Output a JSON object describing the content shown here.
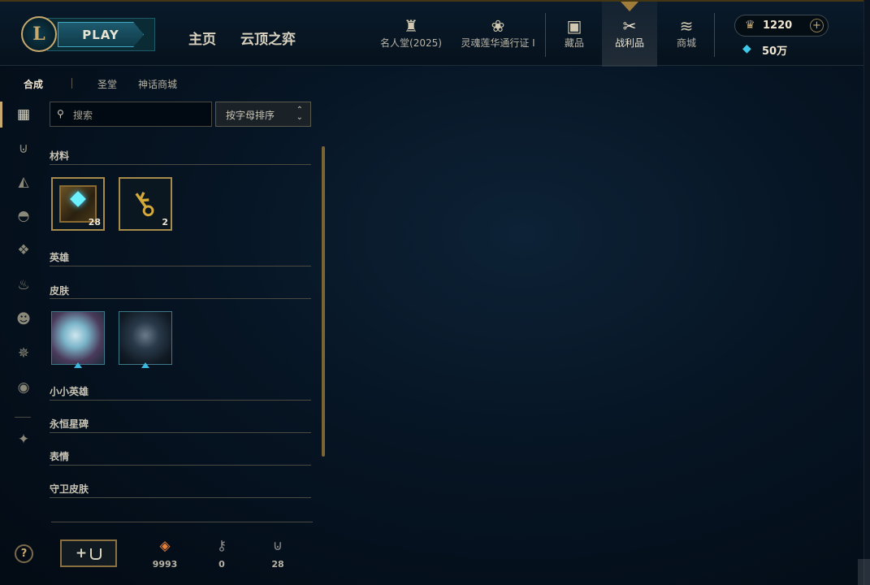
{
  "header": {
    "logo_letter": "L",
    "play_label": "PLAY",
    "main_nav": [
      "主页",
      "云顶之弈"
    ],
    "icon_nav": [
      {
        "label": "名人堂(2025)",
        "icon": "hall-of-fame-icon",
        "glyph": "♜"
      },
      {
        "label": "灵魂莲华通行证 I",
        "icon": "lotus-icon",
        "glyph": "❀"
      },
      {
        "label": "藏品",
        "icon": "collection-bag-icon",
        "glyph": "▣"
      },
      {
        "label": "战利品",
        "icon": "loot-icon",
        "glyph": "✂"
      },
      {
        "label": "商城",
        "icon": "store-coins-icon",
        "glyph": "≋"
      }
    ],
    "active_nav": "战利品",
    "rp_value": "1220",
    "blue_essence_value": "50万",
    "accent_color": "#c8aa6e"
  },
  "subtabs": {
    "items": [
      "合成",
      "圣堂",
      "神话商城"
    ],
    "active": "合成"
  },
  "sidebar": {
    "icons": [
      {
        "name": "all-items-grid-icon",
        "glyph": "▦",
        "active": true
      },
      {
        "name": "chest-icon",
        "glyph": "⊍"
      },
      {
        "name": "champion-helmet-icon",
        "glyph": "◭"
      },
      {
        "name": "skin-mask-icon",
        "glyph": "◓"
      },
      {
        "name": "little-legend-icon",
        "glyph": "❖"
      },
      {
        "name": "ward-flame-icon",
        "glyph": "♨"
      },
      {
        "name": "emote-icon",
        "glyph": "☻"
      },
      {
        "name": "eternals-icon",
        "glyph": "✵"
      },
      {
        "name": "summoner-icon-icon",
        "glyph": "◉"
      },
      {
        "name": "mythic-essence-icon",
        "glyph": "✦"
      }
    ]
  },
  "search": {
    "placeholder": "搜索",
    "value": ""
  },
  "sort": {
    "label": "按字母排序"
  },
  "sections": {
    "materials": "材料",
    "champions": "英雄",
    "skins": "皮肤",
    "little_legends": "小小英雄",
    "eternals": "永恒星碑",
    "emotes": "表情",
    "ward_skins": "守卫皮肤"
  },
  "materials": [
    {
      "name": "hextech-chest",
      "count": "28"
    },
    {
      "name": "hextech-key",
      "count": "2"
    }
  ],
  "skins": [
    {
      "name": "skin-shard-1"
    },
    {
      "name": "skin-shard-2"
    }
  ],
  "footer": {
    "help": "?",
    "add_chest_plus": "+",
    "counters": [
      {
        "name": "orange-essence",
        "value": "9993",
        "color": "#e8823a",
        "glyph": "◈"
      },
      {
        "name": "key-fragment",
        "value": "0",
        "color": "#8a8a8a",
        "glyph": "⚷"
      },
      {
        "name": "chest-count",
        "value": "28",
        "color": "#8a8a8a",
        "glyph": "⊍"
      }
    ]
  }
}
